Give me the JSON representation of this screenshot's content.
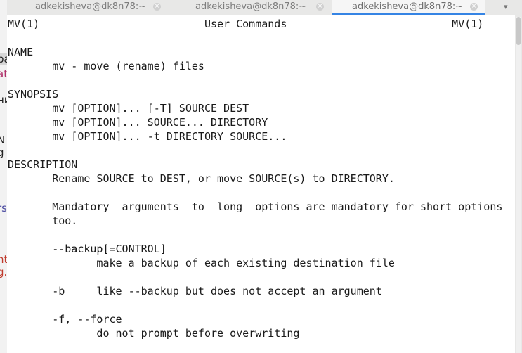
{
  "background_window": {
    "fragments": [
      "pa",
      "ati",
      "ни",
      "N",
      "g",
      "rs",
      "nt",
      "g."
    ]
  },
  "tabs": [
    {
      "label": "adkekisheva@dk8n78:~",
      "active": false
    },
    {
      "label": "adkekisheva@dk8n78:~",
      "active": false
    },
    {
      "label": "adkekisheva@dk8n78:~",
      "active": true
    }
  ],
  "close_glyph": "×",
  "dropdown_glyph": "▾",
  "accent": "#3584e4",
  "terminal": {
    "lines": [
      "MV(1)                          User Commands                          MV(1)",
      "",
      "NAME",
      "       mv - move (rename) files",
      "",
      "SYNOPSIS",
      "       mv [OPTION]... [-T] SOURCE DEST",
      "       mv [OPTION]... SOURCE... DIRECTORY",
      "       mv [OPTION]... -t DIRECTORY SOURCE...",
      "",
      "DESCRIPTION",
      "       Rename SOURCE to DEST, or move SOURCE(s) to DIRECTORY.",
      "",
      "       Mandatory  arguments  to  long  options are mandatory for short options",
      "       too.",
      "",
      "       --backup[=CONTROL]",
      "              make a backup of each existing destination file",
      "",
      "       -b     like --backup but does not accept an argument",
      "",
      "       -f, --force",
      "              do not prompt before overwriting"
    ]
  }
}
